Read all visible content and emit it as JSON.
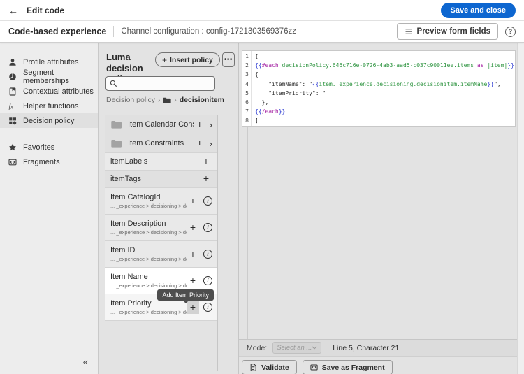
{
  "colors": {
    "accent": "#0d66d0",
    "code_brace": "#2433d0",
    "code_keyword": "#a626a4",
    "code_path": "#2e9440",
    "tooltip_bg": "#4e4e4e"
  },
  "top_bar": {
    "title": "Edit code",
    "save_button": "Save and close"
  },
  "context_bar": {
    "title": "Code-based experience",
    "subtitle": "Channel configuration : config-1721303569376zz",
    "preview_button": "Preview form fields",
    "help_glyph": "?"
  },
  "sidebar": {
    "items": [
      {
        "label": "Profile attributes",
        "icon": "user-icon"
      },
      {
        "label": "Segment memberships",
        "icon": "pie-icon"
      },
      {
        "label": "Contextual attributes",
        "icon": "page-flag-icon"
      },
      {
        "label": "Helper functions",
        "icon": "fx-icon"
      },
      {
        "label": "Decision policy",
        "icon": "grid-icon",
        "selected": true
      },
      {
        "divider": true
      },
      {
        "label": "Favorites",
        "icon": "star-icon"
      },
      {
        "label": "Fragments",
        "icon": "fragment-icon"
      }
    ],
    "collapse_glyph": "«"
  },
  "policy_panel": {
    "title": "Luma decision policy",
    "insert_button": "Insert policy",
    "more_button": "•••",
    "search_placeholder": "",
    "breadcrumb": {
      "root": "Decision policy",
      "current": "decisionitem"
    },
    "tooltip": "Add Item Priority",
    "items": [
      {
        "label": "Item Calendar Constraints",
        "variant": "folder"
      },
      {
        "label": "Item Constraints",
        "variant": "folder"
      },
      {
        "label": "itemLabels",
        "variant": "simple",
        "shade": "light"
      },
      {
        "label": "itemTags",
        "variant": "simple"
      },
      {
        "label": "Item CatalogId",
        "variant": "attr",
        "path": "... _experience > decisioning > decisionitem"
      },
      {
        "label": "Item Description",
        "variant": "attr",
        "path": "... _experience > decisioning > decisionitem"
      },
      {
        "label": "Item ID",
        "variant": "attr",
        "path": "... _experience > decisioning > decisionitem"
      },
      {
        "label": "Item Name",
        "variant": "attr",
        "path": "... _experience > decisioning > decisionitem",
        "highlight": true
      },
      {
        "label": "Item Priority",
        "variant": "attr",
        "path": "... _experience > decisioning > decisionitem",
        "highlight": "soft",
        "plus_hover": true
      }
    ]
  },
  "editor": {
    "cursor_line": 5,
    "lines": [
      [
        [
          "p",
          "["
        ]
      ],
      [
        [
          "b",
          "{{"
        ],
        [
          "k",
          "#each "
        ],
        [
          "g",
          "decisionPolicy.646c716e-0726-4ab3-aad5-c037c90011ee.items"
        ],
        [
          "k",
          " as "
        ],
        [
          "g",
          "|item|"
        ],
        [
          "b",
          "}}"
        ]
      ],
      [
        [
          "p",
          "{"
        ]
      ],
      [
        [
          "p",
          "    \"itemName\": \""
        ],
        [
          "b",
          "{{"
        ],
        [
          "g",
          "item._experience.decisioning.decisionitem.itemName"
        ],
        [
          "b",
          "}}"
        ],
        [
          "p",
          "\","
        ]
      ],
      [
        [
          "p",
          "    \"itemPriority\": \""
        ]
      ],
      [
        [
          "p",
          "  },"
        ]
      ],
      [
        [
          "b",
          "{{"
        ],
        [
          "k",
          "/each"
        ],
        [
          "b",
          "}}"
        ]
      ],
      [
        [
          "p",
          "]"
        ]
      ]
    ]
  },
  "status_bar": {
    "mode_label": "Mode:",
    "mode_value": "Select an ...",
    "position": "Line 5, Character 21"
  },
  "actions": {
    "validate": "Validate",
    "save_as_fragment": "Save as Fragment"
  }
}
